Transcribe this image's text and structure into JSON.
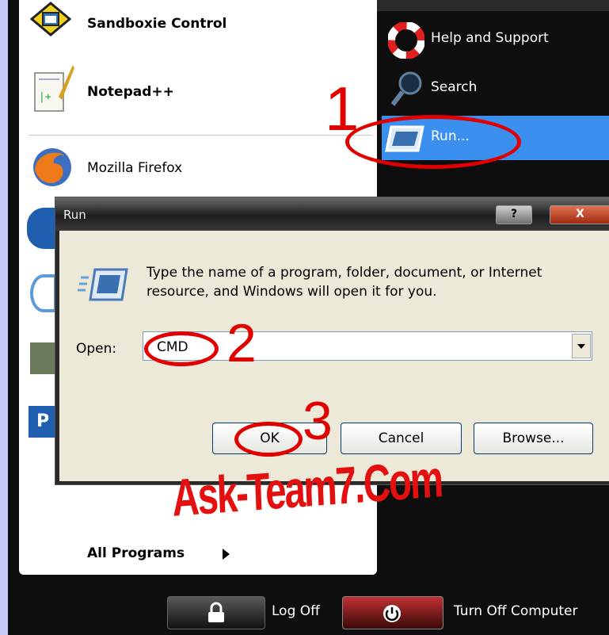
{
  "start_menu": {
    "pinned": [
      {
        "label": "Sandboxie Control",
        "icon": "sandboxie-icon"
      },
      {
        "label": "Notepad++",
        "icon": "notepad-plus-plus-icon"
      },
      {
        "label": "Mozilla Firefox",
        "icon": "firefox-icon"
      }
    ],
    "right": [
      {
        "label": "Help and Support",
        "icon": "help-lifebuoy-icon"
      },
      {
        "label": "Search",
        "icon": "search-magnifier-icon"
      },
      {
        "label": "Run...",
        "icon": "run-icon",
        "selected": true
      }
    ],
    "all_programs": "All Programs",
    "log_off": "Log Off",
    "turn_off": "Turn Off Computer"
  },
  "run_dialog": {
    "title": "Run",
    "help_button": "?",
    "close_button": "X",
    "message": "Type the name of a program, folder, document, or Internet resource, and Windows will open it for you.",
    "open_label": "Open:",
    "open_value": "CMD",
    "ok": "OK",
    "cancel": "Cancel",
    "browse": "Browse..."
  },
  "annotations": {
    "step1": "1",
    "step2": "2",
    "step3": "3",
    "watermark": "Ask-Team7.Com"
  },
  "colors": {
    "annotation_red": "#e00000",
    "selection_blue": "#3a8fef",
    "dialog_face": "#ece9d8"
  }
}
